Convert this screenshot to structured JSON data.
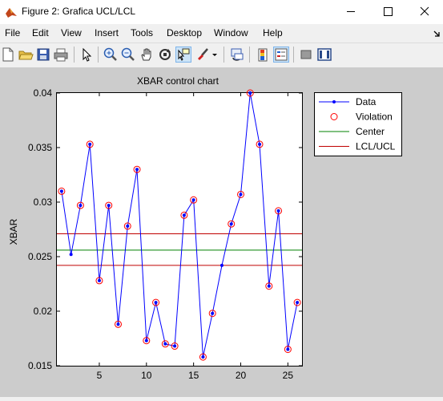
{
  "window": {
    "title": "Figure 2: Grafica UCL/LCL"
  },
  "menu": [
    "File",
    "Edit",
    "View",
    "Insert",
    "Tools",
    "Desktop",
    "Window",
    "Help"
  ],
  "toolbar": {
    "buttons": [
      "new-figure",
      "open-file",
      "save",
      "print",
      "edit-plot",
      "zoom-in",
      "zoom-out",
      "pan",
      "rotate-3d",
      "data-cursor",
      "brush",
      "link-plot",
      "colorbar",
      "legend",
      "hide-plot-tools",
      "show-plot-tools"
    ]
  },
  "chart_data": {
    "type": "line",
    "title": "XBAR control chart",
    "xlabel": "",
    "ylabel": "XBAR",
    "xlim": [
      0.5,
      26.5
    ],
    "ylim": [
      0.015,
      0.04
    ],
    "xticks": [
      5,
      10,
      15,
      20,
      25
    ],
    "yticks": [
      0.015,
      0.02,
      0.025,
      0.03,
      0.035,
      0.04
    ],
    "ytick_labels": [
      "0.015",
      "0.02",
      "0.025",
      "0.03",
      "0.035",
      "0.04"
    ],
    "x": [
      1,
      2,
      3,
      4,
      5,
      6,
      7,
      8,
      9,
      10,
      11,
      12,
      13,
      14,
      15,
      16,
      17,
      18,
      19,
      20,
      21,
      22,
      23,
      24,
      25,
      26
    ],
    "series": [
      {
        "name": "Data",
        "color": "#0000ff",
        "values": [
          0.031,
          0.0252,
          0.0297,
          0.0353,
          0.0228,
          0.0297,
          0.0188,
          0.0278,
          0.033,
          0.0173,
          0.0208,
          0.017,
          0.0168,
          0.0288,
          0.0302,
          0.0158,
          0.0198,
          0.0242,
          0.028,
          0.0307,
          0.04,
          0.0353,
          0.0223,
          0.0292,
          0.0165,
          0.0208
        ]
      }
    ],
    "violation_x": [
      1,
      3,
      4,
      5,
      6,
      7,
      8,
      9,
      10,
      11,
      12,
      13,
      14,
      15,
      16,
      17,
      19,
      20,
      21,
      22,
      23,
      24,
      25,
      26
    ],
    "center": 0.0256,
    "lcl": 0.0242,
    "ucl": 0.0271,
    "legend": {
      "placement": "outside-right",
      "entries": [
        {
          "label": "Data",
          "color": "#0000ff"
        },
        {
          "label": "Violation",
          "color": "#ff0000"
        },
        {
          "label": "Center",
          "color": "#008000"
        },
        {
          "label": "LCL/UCL",
          "color": "#c00000"
        }
      ]
    },
    "grid": false
  }
}
